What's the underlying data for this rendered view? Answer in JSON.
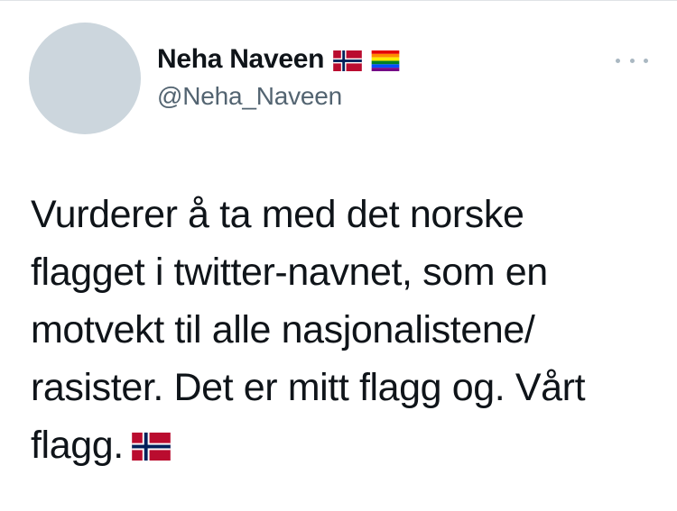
{
  "tweet": {
    "author": {
      "display_name": "Neha Naveen",
      "handle": "@Neha_Naveen",
      "name_icons": [
        "norway-flag-icon",
        "rainbow-flag-icon"
      ]
    },
    "more_icon": "more-options-icon",
    "text_lines": [
      "Vurderer å ta med det norske",
      "flagget i twitter-navnet, som en",
      "motvekt til alle nasjonalistene/",
      "rasister. Det er mitt flagg og. Vårt",
      "flagg."
    ],
    "text_trailing_icon": "norway-flag-icon",
    "colors": {
      "avatar_placeholder": "#ccd6dd",
      "handle": "#536471",
      "text": "#0f1419",
      "norway_red": "#ba0c2f",
      "norway_blue": "#00205b"
    }
  }
}
